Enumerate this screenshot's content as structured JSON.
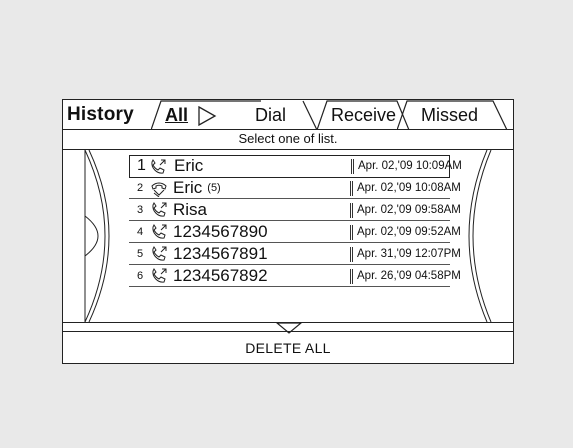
{
  "header": {
    "title": "History",
    "tabs": [
      {
        "label": "All",
        "active": true
      },
      {
        "label": "Dial",
        "active": false
      },
      {
        "label": "Receive",
        "active": false
      },
      {
        "label": "Missed",
        "active": false
      }
    ]
  },
  "instruction": "Select  one of list.",
  "calls": [
    {
      "index": "1",
      "icon": "outgoing-call-icon",
      "name": "Eric",
      "count": "",
      "date": "Apr. 02,'09 10:09AM",
      "selected": true
    },
    {
      "index": "2",
      "icon": "missed-call-icon",
      "name": "Eric",
      "count": "(5)",
      "date": "Apr. 02,'09 10:08AM",
      "selected": false
    },
    {
      "index": "3",
      "icon": "outgoing-call-icon",
      "name": "Risa",
      "count": "",
      "date": "Apr. 02,'09 09:58AM",
      "selected": false
    },
    {
      "index": "4",
      "icon": "outgoing-call-icon",
      "name": "1234567890",
      "count": "",
      "date": "Apr. 02,'09 09:52AM",
      "selected": false
    },
    {
      "index": "5",
      "icon": "outgoing-call-icon",
      "name": "1234567891",
      "count": "",
      "date": "Apr. 31,'09 12:07PM",
      "selected": false
    },
    {
      "index": "6",
      "icon": "outgoing-call-icon",
      "name": "1234567892",
      "count": "",
      "date": "Apr. 26,'09 04:58PM",
      "selected": false
    }
  ],
  "footer": {
    "delete_label": "DELETE ALL"
  },
  "colors": {
    "background": "#e9e9e9",
    "screen": "#ffffff",
    "ink": "#222222"
  }
}
